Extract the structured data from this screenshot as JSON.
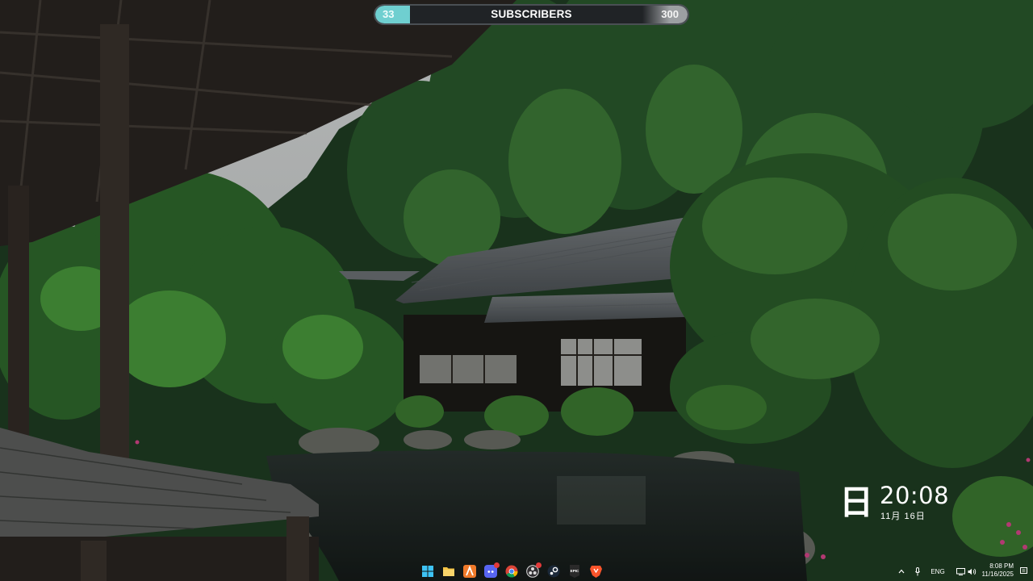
{
  "subscriber_goal": {
    "current": "33",
    "label": "SUBSCRIBERS",
    "goal": "300",
    "progress": 0.11,
    "fill_color": "#6fcfd0"
  },
  "clock_widget": {
    "day_kanji": "日",
    "time": "20:08",
    "date": "11月 16日"
  },
  "taskbar": {
    "apps": [
      {
        "name": "windows-start-icon"
      },
      {
        "name": "file-explorer-icon"
      },
      {
        "name": "app-orange-a-icon"
      },
      {
        "name": "discord-icon",
        "badge": true
      },
      {
        "name": "chrome-icon"
      },
      {
        "name": "obs-icon",
        "badge": true
      },
      {
        "name": "steam-icon"
      },
      {
        "name": "epic-games-icon",
        "text": "EPIC"
      },
      {
        "name": "brave-icon"
      }
    ],
    "tray": {
      "language": "ENG",
      "time": "8:08 PM",
      "date": "11/16/2025"
    }
  }
}
